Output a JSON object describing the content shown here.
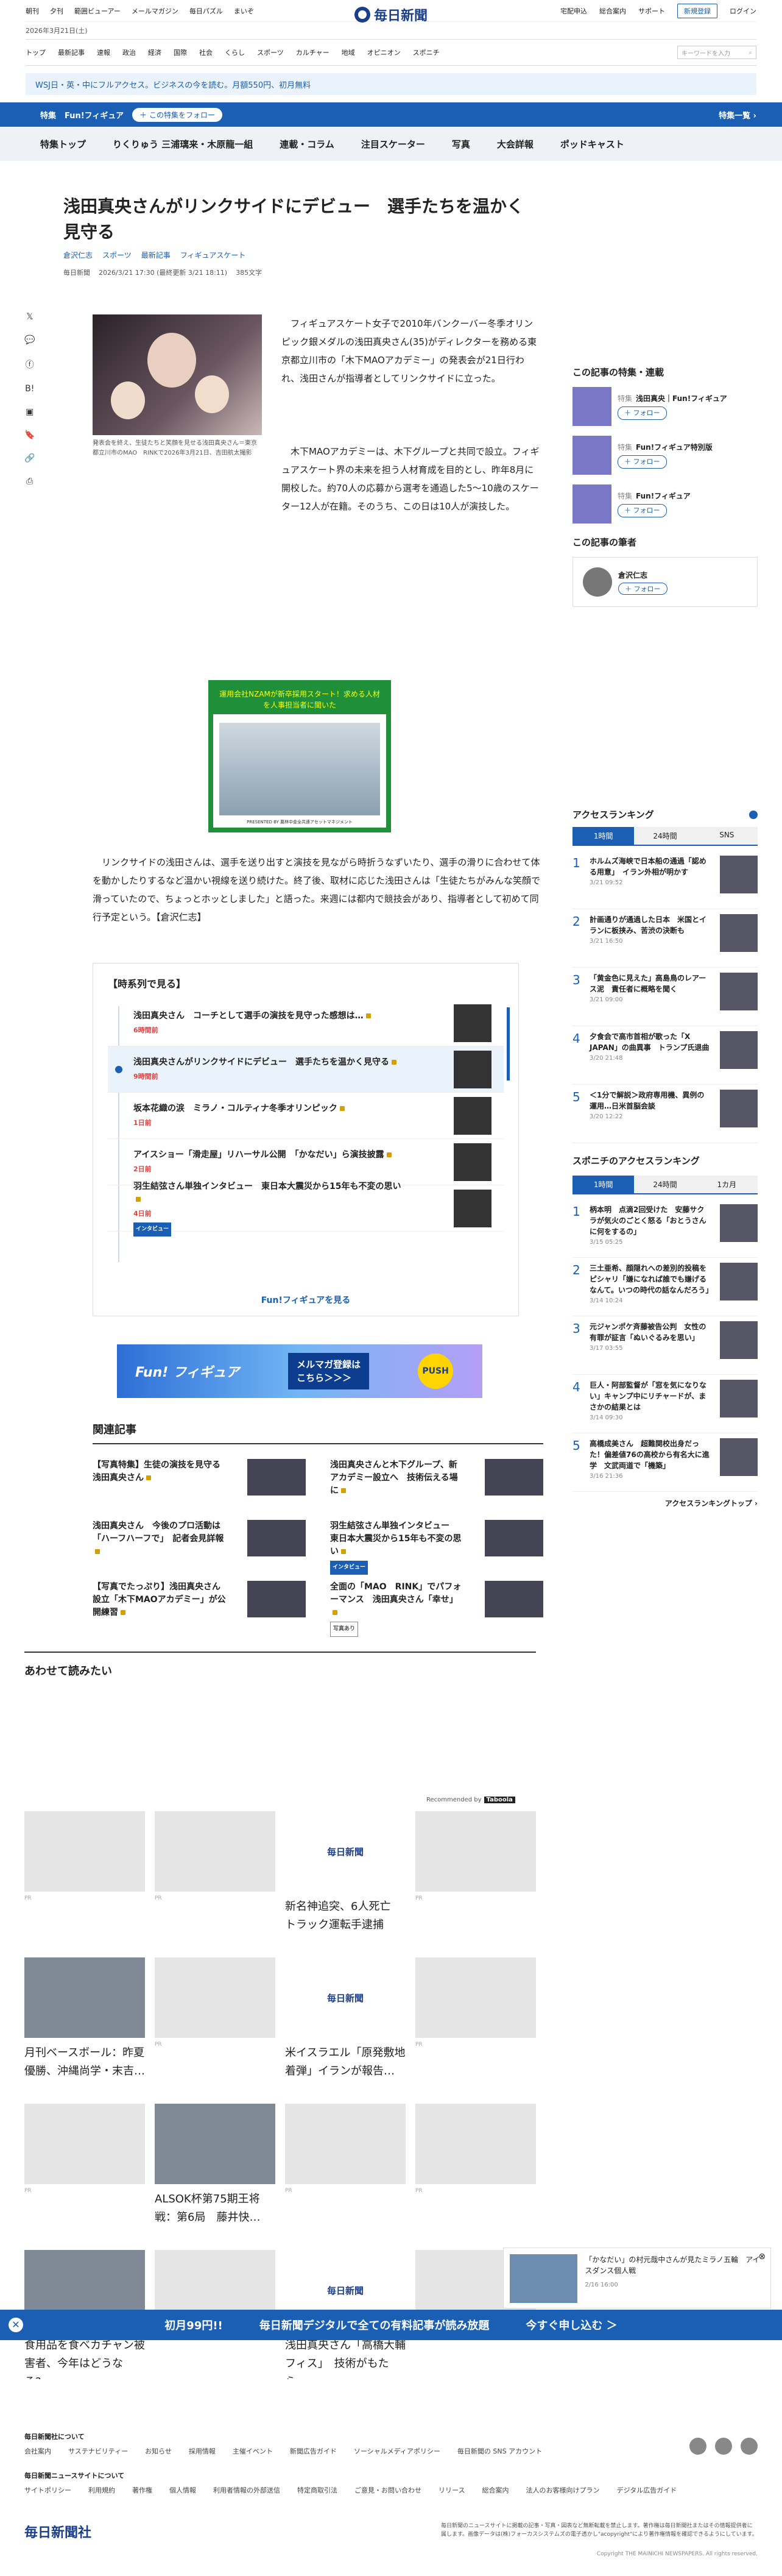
{
  "util": {
    "left": [
      "朝刊",
      "夕刊",
      "範囲ビューアー",
      "メールマガジン",
      "毎日パズル",
      "まいぞ"
    ],
    "right": [
      "宅配申込",
      "総合案内",
      "サポート"
    ],
    "register": "新規登録",
    "login": "ログイン"
  },
  "logo": "毎日新聞",
  "date": "2026年3月21日(土)",
  "nav": [
    "トップ",
    "最新記事",
    "速報",
    "政治",
    "経済",
    "国際",
    "社会",
    "くらし",
    "スポーツ",
    "カルチャー",
    "地域",
    "オピニオン",
    "スポニチ"
  ],
  "search_placeholder": "キーワードを入力",
  "promo": "WSJ日・英・中にフルアクセス。ビジネスの今を読む。月額550円、初月無料",
  "tokushu": {
    "tag": "特集",
    "name": "Fun!フィギュア",
    "follow": "＋ この特集をフォロー",
    "more": "特集一覧 ›"
  },
  "subnav": [
    "特集トップ",
    "りくりゅう 三浦璃来・木原龍一組",
    "連載・コラム",
    "注目スケーター",
    "写真",
    "大会詳報",
    "ポッドキャスト"
  ],
  "article": {
    "title": "浅田真央さんがリンクサイドにデビュー　選手たちを温かく見守る",
    "author": "倉沢仁志",
    "tags": [
      "スポーツ",
      "最新記事",
      "フィギュアスケート"
    ],
    "source": "毎日新聞",
    "datetime": "2026/3/21 17:30 (最終更新 3/21 18:11)",
    "chars": "385文字",
    "caption": "発表会を終え、生徒たちと笑顔を見せる浅田真央さん＝東京都立川市のMAO　RINKで2026年3月21日、吉田航太撮影",
    "p1": "フィギュアスケート女子で2010年バンクーバー冬季オリンピック銀メダルの浅田真央さん(35)がディレクターを務める東京都立川市の「木下MAOアカデミー」の発表会が21日行われ、浅田さんが指導者としてリンクサイドに立った。",
    "p2": "木下MAOアカデミーは、木下グループと共同で設立。フィギュアスケート界の未来を担う人材育成を目的とし、昨年8月に開校した。約70人の応募から選考を通過した5〜10歳のスケーター12人が在籍。そのうち、この日は10人が演技した。",
    "p3": "リンクサイドの浅田さんは、選手を送り出すと演技を見ながら時折うなずいたり、選手の滑りに合わせて体を動かしたりするなど温かい視線を送り続けた。終了後、取材に応じた浅田さんは「生徒たちがみんな笑顔で滑っていたので、ちょっとホッとしました」と語った。来週には都内で競技会があり、指導者として初めて同行予定という。【倉沢仁志】"
  },
  "ad1": {
    "title": "運用会社NZAMが新卒採用スタート！求める人材を人事担当者に聞いた",
    "sub": "PRESENTED BY 農林中金全共連アセットマネジメント"
  },
  "timeline": {
    "title": "【時系列で見る】",
    "items": [
      {
        "title": "浅田真央さん　コーチとして選手の演技を見守った感想は…",
        "date": "6時間前"
      },
      {
        "title": "浅田真央さんがリンクサイドにデビュー　選手たちを温かく見守る",
        "date": "9時間前"
      },
      {
        "title": "坂本花織の涙　ミラノ・コルティナ冬季オリンピック",
        "date": "1日前"
      },
      {
        "title": "アイスショー「滑走屋」リハーサル公開　「かなだい」ら演技披露",
        "date": "2日前"
      },
      {
        "title": "羽生結弦さん単独インタビュー　東日本大震災から15年も不変の思い",
        "date": "4日前",
        "badge": "インタビュー"
      }
    ],
    "more": "Fun!フィギュアを見る"
  },
  "ad2": {
    "brand": "Fun! フィギュア",
    "msg": "メルマガ登録は\nこちら＞＞＞",
    "push": "PUSH"
  },
  "related": {
    "title": "関連記事",
    "items": [
      {
        "title": "【写真特集】生徒の演技を見守る浅田真央さん"
      },
      {
        "title": "浅田真央さんと木下グループ、新アカデミー設立へ　技術伝える場に"
      },
      {
        "title": "浅田真央さん　今後のプロ活動は「ハーフハーフで」　記者会見詳報"
      },
      {
        "title": "羽生結弦さん単独インタビュー　東日本大震災から15年も不変の思い",
        "badge": "インタビュー"
      },
      {
        "title": "【写真でたっぷり】浅田真央さん設立「木下MAOアカデミー」が公開練習"
      },
      {
        "title": "全面の「MAO　RINK」でパフォーマンス　浅田真央さん「幸せ」",
        "badge2": "写真あり"
      }
    ]
  },
  "side": {
    "series_title": "この記事の特集・連載",
    "series": [
      {
        "tag": "特集",
        "name": "浅田真央｜Fun!フィギュア",
        "btn": "＋ フォロー"
      },
      {
        "tag": "特集",
        "name": "Fun!フィギュア特別版",
        "btn": "＋ フォロー"
      },
      {
        "tag": "特集",
        "name": "Fun!フィギュア",
        "btn": "＋ フォロー"
      }
    ],
    "author_title": "この記事の筆者",
    "author": "倉沢仁志",
    "author_btn": "＋ フォロー",
    "ranking_title": "アクセスランキング",
    "rank_tabs": [
      "1時間",
      "24時間",
      "SNS"
    ],
    "ranking": [
      {
        "n": "1",
        "t": "ホルムズ海峡で日本船の通過「認める用意」　イラン外相が明かす",
        "d": "3/21 09:52"
      },
      {
        "n": "2",
        "t": "計画通りが通過した日本　米国とイランに板挟み、苦渋の決断も",
        "d": "3/21 16:50"
      },
      {
        "n": "3",
        "t": "「黄金色に見えた」高島鳥のレアース泥　責任者に概略を聞く",
        "d": "3/21 09:00"
      },
      {
        "n": "4",
        "t": "夕食会で高市首相が歌った「X JAPAN」の曲異事　トランプ氏退曲",
        "d": "3/20 21:48"
      },
      {
        "n": "5",
        "t": "＜1分で解説＞政府専用機、異例の運用…日米首脳会談",
        "d": "3/20 12:22"
      }
    ],
    "sponichi_title": "スポニチのアクセスランキング",
    "sp_tabs": [
      "1時間",
      "24時間",
      "1カ月"
    ],
    "sponichi": [
      {
        "n": "1",
        "t": "柄本明　点滴2回受けた　安藤サクラが気火のごとく怒る「おとうさんに何をするの」",
        "d": "3/15 05:25"
      },
      {
        "n": "2",
        "t": "三土亜希、顔隠れへの差別的投稿をピシャリ「嫌になれば誰でも嫌げるなんて。いつの時代の話なんだろう」",
        "d": "3/14 10:24"
      },
      {
        "n": "3",
        "t": "元ジャンポケ斉藤被告公判　女性の有罪が証言「ぬいぐるみを思い」",
        "d": "3/17 03:55"
      },
      {
        "n": "4",
        "t": "巨人・阿部監督が「窓を気になりない」キャンプ中にリチャードが、まさかの結果とは",
        "d": "3/14 09:30"
      },
      {
        "n": "5",
        "t": "高橋成美さん　超難関校出身だった！偏差値76の高校から有名大に進学　文武両道で「機築」",
        "d": "3/16 21:36"
      }
    ],
    "rank_more": "アクセスランキングトップ ›"
  },
  "awase": "あわせて読みたい",
  "recommended": "Recommended by",
  "cards1": [
    {
      "t": "",
      "pr": "PR"
    },
    {
      "t": "",
      "pr": "PR"
    },
    {
      "t": "新名神追突、6人死亡　トラック運転手逮捕",
      "logo": "毎日新聞"
    },
    {
      "t": "",
      "pr": "PR"
    }
  ],
  "cards2": [
    {
      "t": "月刊ベースボール：昨夏優勝、沖縄尚学・末吉…"
    },
    {
      "t": "",
      "pr": "PR"
    },
    {
      "t": "米イスラエル「原発敷地着弾」イランが報告…",
      "logo": "毎日新聞"
    },
    {
      "t": "",
      "pr": "PR"
    }
  ],
  "cards3": [
    {
      "t": "",
      "pr": "PR"
    },
    {
      "t": "ALSOK杯第75期王将戦：第6局　藤井快…"
    },
    {
      "t": "",
      "pr": "PR"
    },
    {
      "t": "",
      "pr": "PR"
    }
  ],
  "cards4": [
    {
      "t": "食用品を食べカチャン被害者、今年はどうなる?…"
    },
    {
      "t": "",
      "pr": "PR"
    },
    {
      "t": "浅田真央さん「高橋大輔フィス」　技術がもたら…",
      "logo": "毎日新聞"
    },
    {
      "t": "",
      "pr": "PR"
    }
  ],
  "toast": {
    "t": "「かなだい」の村元哉中さんが見たミラノ五輪　アイスダンス個人戦",
    "d": "2/16 16:00"
  },
  "bottom_bar": {
    "a": "初月99円!!",
    "b": "毎日新聞デジタルで全ての有料記事が読み放題",
    "c": "今すぐ申し込む ＞"
  },
  "footer": {
    "h1": "毎日新聞社について",
    "r1": [
      "会社案内",
      "サステナビリティー",
      "お知らせ",
      "採用情報",
      "主催イベント",
      "新聞広告ガイド",
      "ソーシャルメディアポリシー",
      "毎日新聞の SNS アカウント"
    ],
    "h2": "毎日新聞ニュースサイトについて",
    "r2": [
      "サイトポリシー",
      "利用規約",
      "著作権",
      "個人情報",
      "利用者情報の外部送信",
      "特定商取引法",
      "ご意見・お問い合わせ",
      "リリース",
      "総合案内",
      "法人のお客様向けプラン",
      "デジタル広告ガイド"
    ],
    "logo": "毎日新聞社",
    "notice": "毎日新聞のニュースサイトに掲載の記事・写真・図表など無断転載を禁止します。著作権は毎日新聞社またはその情報提供者に属します。画像データは(株)フォーカスシステムズの電子透かし\"acopyright\"により著作権情報を確認できるようにしています。",
    "copyright": "Copyright THE MAINICHI NEWSPAPERS. All rights reserved."
  }
}
